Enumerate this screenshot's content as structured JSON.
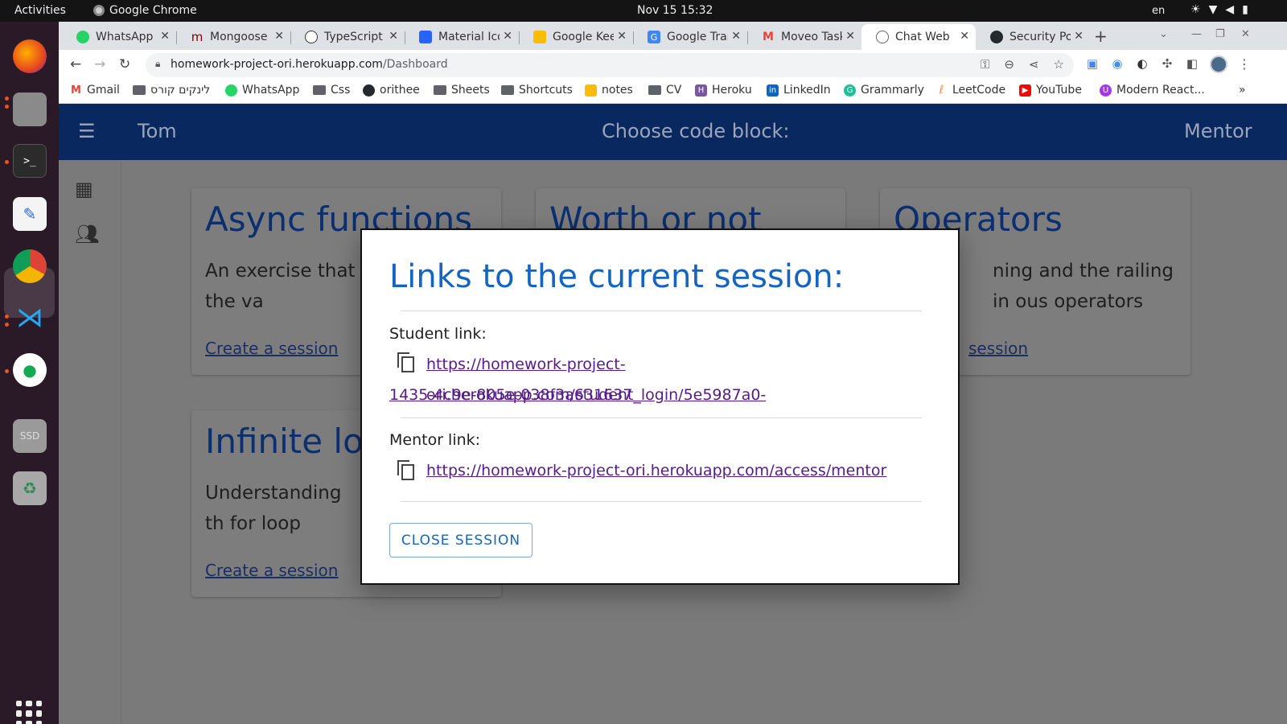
{
  "os": {
    "activities": "Activities",
    "app_name": "Google Chrome",
    "clock": "Nov 15  15:32",
    "lang": "en"
  },
  "tabs": [
    {
      "label": "WhatsApp",
      "icon": "whatsapp-icon",
      "color": "#25d366"
    },
    {
      "label": "Mongoose v",
      "icon": "mongoose-icon",
      "color": "#800000"
    },
    {
      "label": "TypeScript |",
      "icon": "compass-icon",
      "color": "#333333"
    },
    {
      "label": "Material Ico",
      "icon": "material-icon",
      "color": "#2962ff"
    },
    {
      "label": "Google Kee",
      "icon": "keep-icon",
      "color": "#fbbc04"
    },
    {
      "label": "Google Tran",
      "icon": "translate-icon",
      "color": "#4285f4"
    },
    {
      "label": "Moveo Task",
      "icon": "gmail-icon",
      "color": "#ea4335"
    },
    {
      "label": "Chat Web",
      "icon": "chat-icon",
      "color": "#5f6368",
      "active": true
    },
    {
      "label": "Security Pol",
      "icon": "github-icon",
      "color": "#24292e"
    }
  ],
  "address": {
    "host": "homework-project-ori.herokuapp.com",
    "path": "/Dashboard"
  },
  "bookmarks": [
    {
      "label": "Gmail",
      "icon": "gmail-icon"
    },
    {
      "label": "לינקים קורס",
      "icon": "folder-icon"
    },
    {
      "label": "WhatsApp",
      "icon": "whatsapp-icon"
    },
    {
      "label": "Css",
      "icon": "folder-icon"
    },
    {
      "label": "orithee",
      "icon": "github-icon"
    },
    {
      "label": "Sheets",
      "icon": "folder-icon"
    },
    {
      "label": "Shortcuts",
      "icon": "folder-icon"
    },
    {
      "label": "notes",
      "icon": "keep-icon"
    },
    {
      "label": "CV",
      "icon": "folder-icon"
    },
    {
      "label": "Heroku",
      "icon": "heroku-icon"
    },
    {
      "label": "LinkedIn",
      "icon": "linkedin-icon"
    },
    {
      "label": "Grammarly",
      "icon": "grammarly-icon"
    },
    {
      "label": "LeetCode",
      "icon": "leetcode-icon"
    },
    {
      "label": "YouTube",
      "icon": "youtube-icon"
    },
    {
      "label": "Modern React...",
      "icon": "udemy-icon"
    }
  ],
  "app": {
    "user": "Tom",
    "title": "Choose code block:",
    "role": "Mentor",
    "cards": [
      {
        "title": "Async functions",
        "desc": "An exercise that h understand the va",
        "link": "Create a session"
      },
      {
        "title": "Worth or not",
        "desc": "",
        "link": ""
      },
      {
        "title": "Operators",
        "desc": "ning and the railing in ous operators",
        "link": "session"
      },
      {
        "title": "Infinite loo",
        "desc": "Understanding th for loop",
        "link": "Create a session"
      }
    ]
  },
  "modal": {
    "title": "Links to the current session:",
    "student_label": "Student link:",
    "student_link_line1": "https://homework-project-ori.herokuapp.com/student_login/5e5987a0-",
    "student_link_line2": "1435-4c9e-805e-038f3a631637",
    "mentor_label": "Mentor link:",
    "mentor_link": "https://homework-project-ori.herokuapp.com/access/mentor",
    "close_button": "CLOSE SESSION"
  },
  "colors": {
    "appbar": "#0a2860",
    "modal_title": "#1565c0",
    "link_visited": "#551a8b",
    "overlay": "#7a7a7a"
  }
}
